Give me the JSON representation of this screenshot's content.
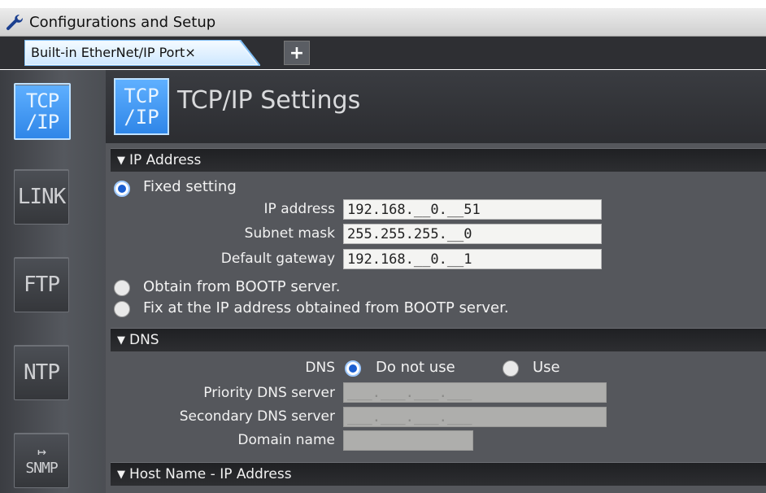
{
  "window": {
    "title": "Configurations and Setup"
  },
  "tabs": {
    "active_label": "Built-in EtherNet/IP Port×",
    "add_label": "+"
  },
  "sidebar": {
    "items": [
      {
        "label_top": "TCP",
        "label_bottom": "/IP",
        "active": true
      },
      {
        "label": "LINK"
      },
      {
        "label": "FTP"
      },
      {
        "label": "NTP"
      },
      {
        "label": "SNMP",
        "icon": "export-arrow-icon"
      }
    ]
  },
  "header": {
    "icon_top": "TCP",
    "icon_bottom": "/IP",
    "title": "TCP/IP Settings"
  },
  "ip_section": {
    "title": "IP Address",
    "fixed_label": "Fixed setting",
    "ip_label": "IP address",
    "ip_value": "192.168.__0.__51",
    "subnet_label": "Subnet mask",
    "subnet_value": "255.255.255.__0",
    "gateway_label": "Default gateway",
    "gateway_value": "192.168.__0.__1",
    "bootp_label": "Obtain from BOOTP server.",
    "fix_bootp_label": "Fix at the IP address obtained from BOOTP server.",
    "selected": "fixed"
  },
  "dns_section": {
    "title": "DNS",
    "dns_label": "DNS",
    "do_not_use_label": "Do not use",
    "use_label": "Use",
    "selected": "do_not_use",
    "priority_label": "Priority DNS server",
    "priority_value": "___.___.___.___",
    "secondary_label": "Secondary DNS server",
    "secondary_value": "___.___.___.___",
    "domain_label": "Domain name",
    "domain_value": ""
  },
  "host_section": {
    "title": "Host Name - IP Address"
  },
  "colors": {
    "accent": "#2f86e8",
    "panel": "#55575c",
    "header_bar": "#1f2023"
  }
}
